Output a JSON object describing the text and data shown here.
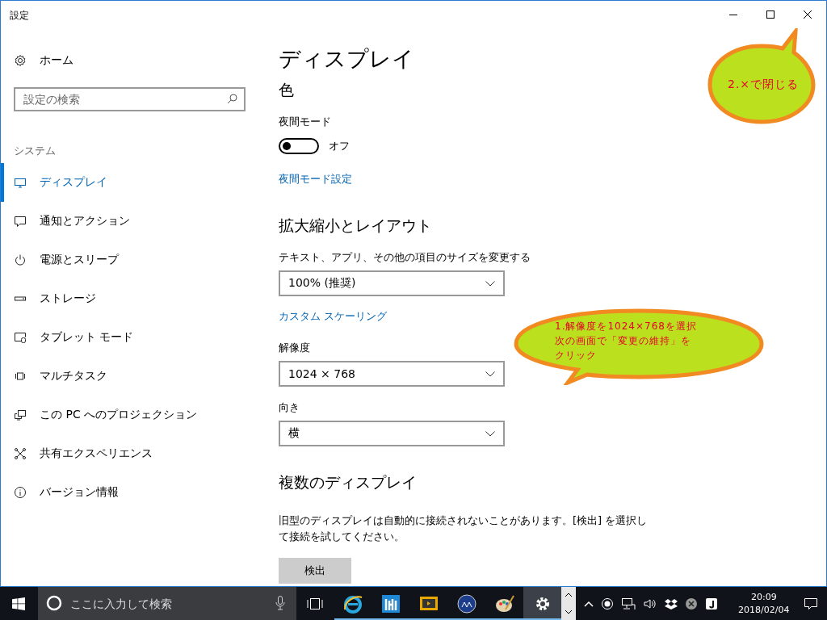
{
  "window": {
    "title": "設定"
  },
  "sidebar": {
    "home": "ホーム",
    "search": {
      "placeholder": "設定の検索"
    },
    "group": "システム",
    "items": [
      {
        "label": "ディスプレイ",
        "kind": "monitor",
        "selected": true
      },
      {
        "label": "通知とアクション",
        "kind": "message",
        "selected": false
      },
      {
        "label": "電源とスリープ",
        "kind": "power",
        "selected": false
      },
      {
        "label": "ストレージ",
        "kind": "storage",
        "selected": false
      },
      {
        "label": "タブレット モード",
        "kind": "tablet",
        "selected": false
      },
      {
        "label": "マルチタスク",
        "kind": "multitask",
        "selected": false
      },
      {
        "label": "この PC へのプロジェクション",
        "kind": "project",
        "selected": false
      },
      {
        "label": "共有エクスペリエンス",
        "kind": "share",
        "selected": false
      },
      {
        "label": "バージョン情報",
        "kind": "info",
        "selected": false
      }
    ]
  },
  "content": [
    {
      "kind": "title",
      "text": "ディスプレイ"
    },
    {
      "kind": "section",
      "text": "色"
    },
    {
      "kind": "label",
      "text": "夜間モード"
    },
    {
      "kind": "toggle",
      "on": false,
      "text": "オフ"
    },
    {
      "kind": "link",
      "text": "夜間モード設定"
    },
    {
      "kind": "section",
      "text": "拡大縮小とレイアウト"
    },
    {
      "kind": "label",
      "text": "テキスト、アプリ、その他の項目のサイズを変更する"
    },
    {
      "kind": "dropdown",
      "text": "100% (推奨)"
    },
    {
      "kind": "link",
      "text": "カスタム スケーリング"
    },
    {
      "kind": "label",
      "text": "解像度"
    },
    {
      "kind": "dropdown",
      "text": "1024 × 768"
    },
    {
      "kind": "label",
      "text": "向き"
    },
    {
      "kind": "dropdown",
      "text": "横"
    },
    {
      "kind": "section",
      "text": "複数のディスプレイ"
    },
    {
      "kind": "paragraph",
      "text": "旧型のディスプレイは自動的に接続されないことがあります。[検出] を選択して接続を試してください。"
    },
    {
      "kind": "button",
      "text": "検出"
    }
  ],
  "callouts": [
    {
      "kind": "wide",
      "lines": [
        "1.解像度を1024×768を選択",
        "次の画面で「変更の維持」を",
        "クリック"
      ]
    },
    {
      "kind": "round",
      "lines": [
        "2.×で閉じる"
      ]
    }
  ],
  "taskbar": {
    "search": {
      "placeholder": "ここに入力して検索"
    },
    "apps": [
      {
        "kind": "ie",
        "selected": false
      },
      {
        "kind": "blue",
        "selected": false
      },
      {
        "kind": "yellow",
        "selected": false
      },
      {
        "kind": "globe",
        "selected": false
      },
      {
        "kind": "palette",
        "selected": false
      },
      {
        "kind": "gear",
        "selected": true
      }
    ],
    "time": "20:09",
    "date": "2018/02/04"
  }
}
